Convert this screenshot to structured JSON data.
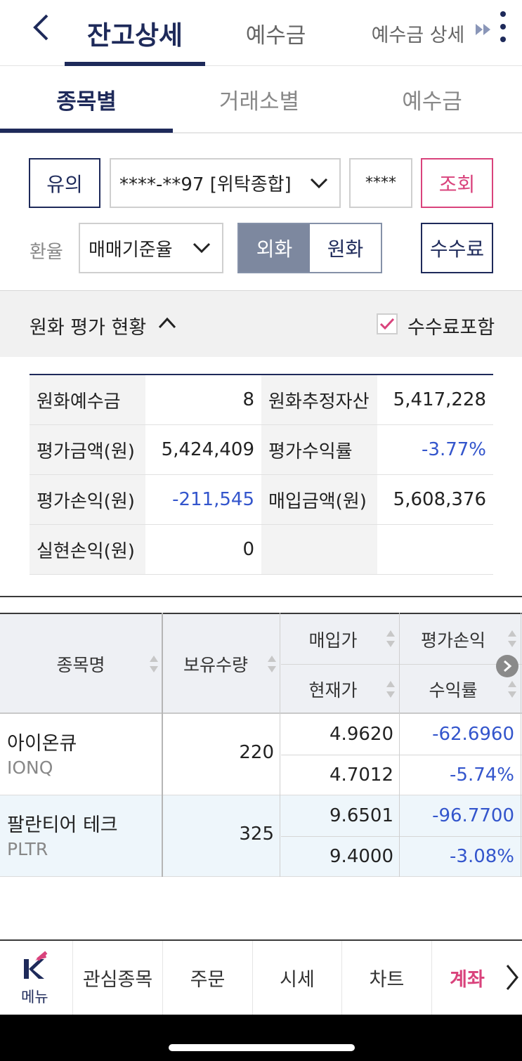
{
  "header": {
    "tabs": [
      {
        "label": "잔고상세",
        "active": true
      },
      {
        "label": "예수금",
        "active": false
      },
      {
        "label": "예수금 상세",
        "active": false
      }
    ]
  },
  "sub_tabs": [
    {
      "label": "종목별",
      "active": true
    },
    {
      "label": "거래소별",
      "active": false
    },
    {
      "label": "예수금",
      "active": false
    }
  ],
  "controls": {
    "notice_button": "유의",
    "account_select": "****-**97 [위탁종합]",
    "password": "****",
    "query_button": "조회",
    "rate_label": "환율",
    "rate_select": "매매기준율",
    "currency_toggle": [
      "외화",
      "원화"
    ],
    "currency_selected": "외화",
    "fee_button": "수수료"
  },
  "section": {
    "title": "원화 평가 현황",
    "fee_include_label": "수수료포함",
    "fee_include_checked": true
  },
  "summary": {
    "rows": [
      [
        {
          "label": "원화예수금",
          "value": "8"
        },
        {
          "label": "원화추정자산",
          "value": "5,417,228"
        }
      ],
      [
        {
          "label": "평가금액(원)",
          "value": "5,424,409"
        },
        {
          "label": "평가수익률",
          "value": "-3.77%"
        }
      ],
      [
        {
          "label": "평가손익(원)",
          "value": "-211,545"
        },
        {
          "label": "매입금액(원)",
          "value": "5,608,376"
        }
      ],
      [
        {
          "label": "실현손익(원)",
          "value": "0"
        },
        {
          "label": "",
          "value": ""
        }
      ]
    ]
  },
  "holdings": {
    "headers": {
      "name": "종목명",
      "qty": "보유수량",
      "buy_price": "매입가",
      "eval_pl": "평가손익",
      "cur_price": "현재가",
      "return_rate": "수익률"
    },
    "rows": [
      {
        "name": "아이온큐",
        "ticker": "IONQ",
        "qty": "220",
        "buy_price": "4.9620",
        "eval_pl": "-62.6960",
        "cur_price": "4.7012",
        "return_rate": "-5.74%"
      },
      {
        "name": "팔란티어 테크",
        "ticker": "PLTR",
        "qty": "325",
        "buy_price": "9.6501",
        "eval_pl": "-96.7700",
        "cur_price": "9.4000",
        "return_rate": "-3.08%"
      }
    ]
  },
  "bottom_nav": {
    "menu_label": "메뉴",
    "items": [
      "관심종목",
      "주문",
      "시세",
      "차트",
      "계좌"
    ],
    "active": "계좌"
  },
  "colors": {
    "navy": "#1e2a5a",
    "pink": "#d9437c",
    "negative_blue": "#3355cc",
    "toggle_grey": "#7d889f"
  }
}
